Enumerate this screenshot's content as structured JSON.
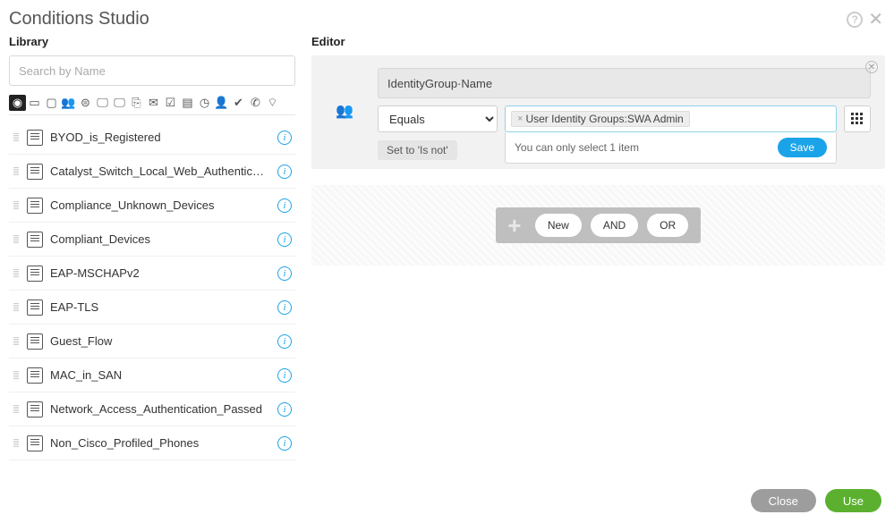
{
  "title": "Conditions Studio",
  "library": {
    "title": "Library",
    "search_placeholder": "Search by Name",
    "items": [
      {
        "label": "BYOD_is_Registered"
      },
      {
        "label": "Catalyst_Switch_Local_Web_Authentication"
      },
      {
        "label": "Compliance_Unknown_Devices"
      },
      {
        "label": "Compliant_Devices"
      },
      {
        "label": "EAP-MSCHAPv2"
      },
      {
        "label": "EAP-TLS"
      },
      {
        "label": "Guest_Flow"
      },
      {
        "label": "MAC_in_SAN"
      },
      {
        "label": "Network_Access_Authentication_Passed"
      },
      {
        "label": "Non_Cisco_Profiled_Phones"
      }
    ],
    "filter_icons": [
      "location",
      "id-card",
      "device",
      "group",
      "globe",
      "monitor1",
      "monitor2",
      "cert",
      "msg",
      "doc",
      "app",
      "clock",
      "person",
      "check",
      "phone",
      "wifi"
    ]
  },
  "editor": {
    "title": "Editor",
    "attribute": "IdentityGroup·Name",
    "operator": "Equals",
    "value_tag": "User Identity Groups:SWA Admin",
    "dropdown_msg": "You can only select 1 item",
    "save_label": "Save",
    "set_not_label": "Set to 'Is not'",
    "add": {
      "new": "New",
      "and": "AND",
      "or": "OR"
    }
  },
  "footer": {
    "close": "Close",
    "use": "Use"
  }
}
